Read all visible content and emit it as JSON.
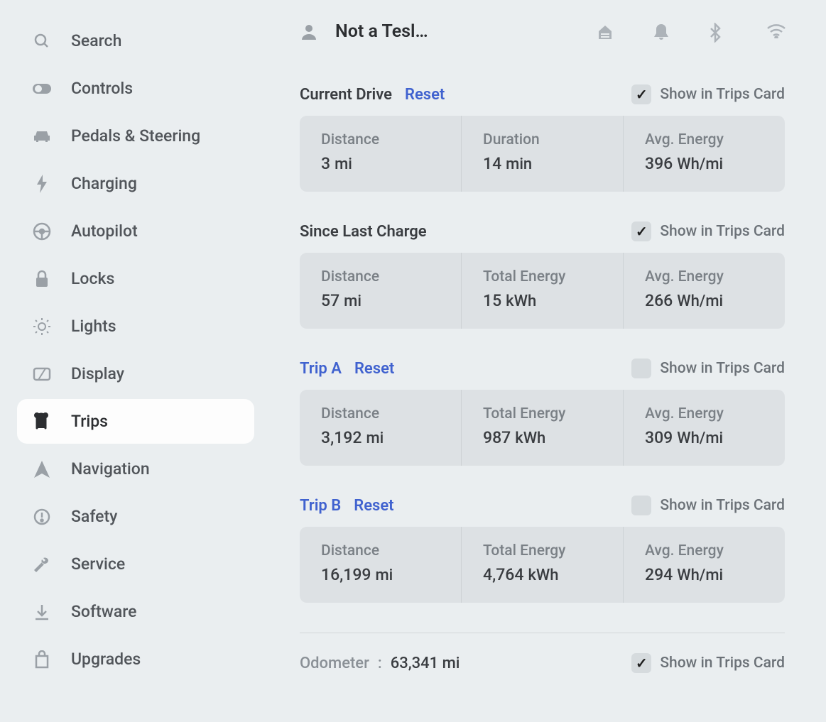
{
  "sidebar": {
    "items": [
      {
        "label": "Search"
      },
      {
        "label": "Controls"
      },
      {
        "label": "Pedals & Steering"
      },
      {
        "label": "Charging"
      },
      {
        "label": "Autopilot"
      },
      {
        "label": "Locks"
      },
      {
        "label": "Lights"
      },
      {
        "label": "Display"
      },
      {
        "label": "Trips"
      },
      {
        "label": "Navigation"
      },
      {
        "label": "Safety"
      },
      {
        "label": "Service"
      },
      {
        "label": "Software"
      },
      {
        "label": "Upgrades"
      }
    ]
  },
  "topbar": {
    "user_name": "Not a Tesl…"
  },
  "sections": {
    "current_drive": {
      "title": "Current Drive",
      "reset": "Reset",
      "show_label": "Show in Trips Card",
      "metrics": {
        "distance": {
          "label": "Distance",
          "value": "3",
          "unit": "mi"
        },
        "duration": {
          "label": "Duration",
          "value": "14",
          "unit": "min"
        },
        "avg_energy": {
          "label": "Avg. Energy",
          "value": "396",
          "unit": "Wh/mi"
        }
      }
    },
    "since_last_charge": {
      "title": "Since Last Charge",
      "show_label": "Show in Trips Card",
      "metrics": {
        "distance": {
          "label": "Distance",
          "value": "57",
          "unit": "mi"
        },
        "total_energy": {
          "label": "Total Energy",
          "value": "15",
          "unit": "kWh"
        },
        "avg_energy": {
          "label": "Avg. Energy",
          "value": "266",
          "unit": "Wh/mi"
        }
      }
    },
    "trip_a": {
      "title": "Trip A",
      "reset": "Reset",
      "show_label": "Show in Trips Card",
      "metrics": {
        "distance": {
          "label": "Distance",
          "value": "3,192",
          "unit": "mi"
        },
        "total_energy": {
          "label": "Total Energy",
          "value": "987",
          "unit": "kWh"
        },
        "avg_energy": {
          "label": "Avg. Energy",
          "value": "309",
          "unit": "Wh/mi"
        }
      }
    },
    "trip_b": {
      "title": "Trip B",
      "reset": "Reset",
      "show_label": "Show in Trips Card",
      "metrics": {
        "distance": {
          "label": "Distance",
          "value": "16,199",
          "unit": "mi"
        },
        "total_energy": {
          "label": "Total Energy",
          "value": "4,764",
          "unit": "kWh"
        },
        "avg_energy": {
          "label": "Avg. Energy",
          "value": "294",
          "unit": "Wh/mi"
        }
      }
    }
  },
  "odometer": {
    "label": "Odometer",
    "value": "63,341 mi",
    "show_label": "Show in Trips Card"
  }
}
